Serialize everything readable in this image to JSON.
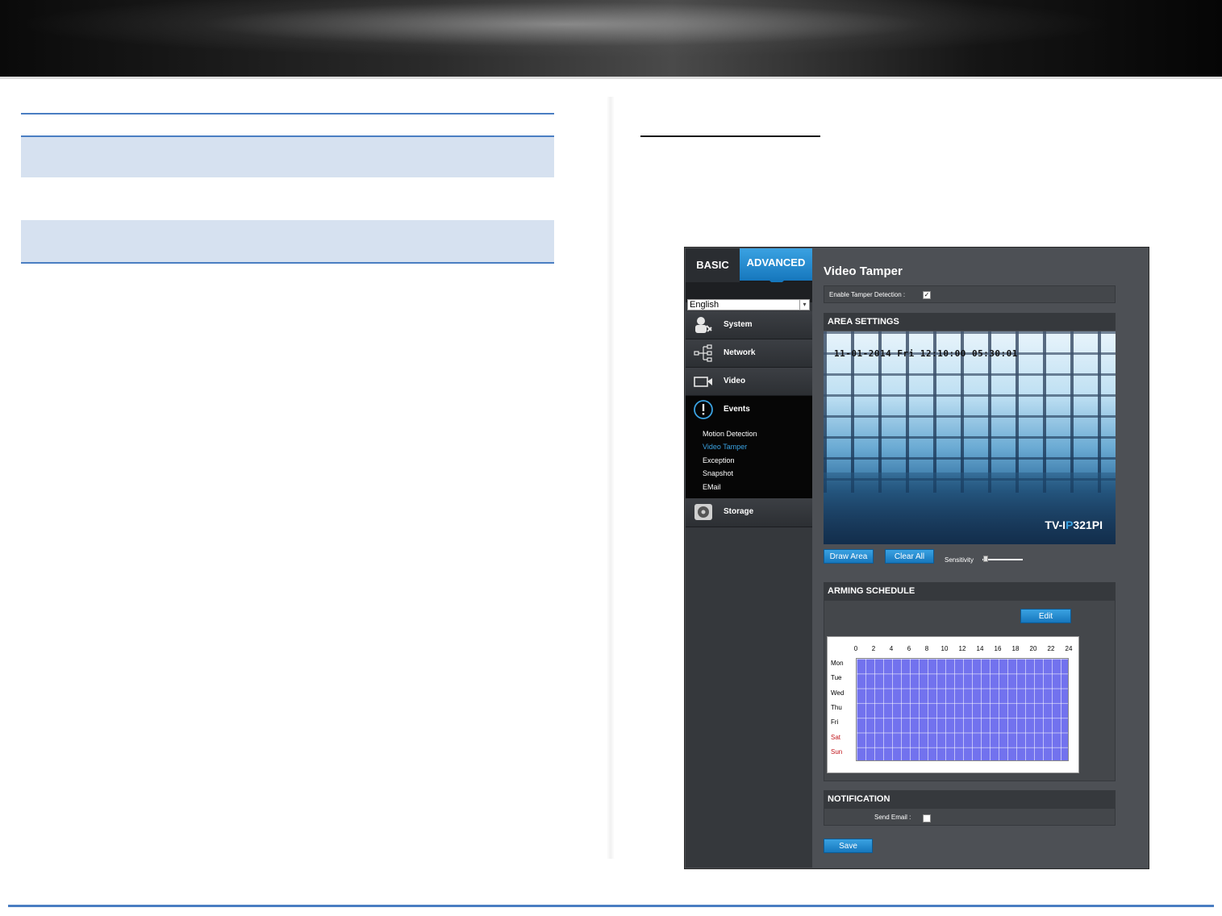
{
  "app": {
    "tabs": {
      "basic": "BASIC",
      "advanced": "ADVANCED"
    },
    "language": "English",
    "menu": [
      {
        "label": "System",
        "icon": "system-admin-icon"
      },
      {
        "label": "Network",
        "icon": "network-icon"
      },
      {
        "label": "Video",
        "icon": "video-camera-icon"
      },
      {
        "label": "Events",
        "icon": "alert-icon"
      },
      {
        "label": "Storage",
        "icon": "disk-icon"
      }
    ],
    "events_submenu": [
      "Motion Detection",
      "Video Tamper",
      "Exception",
      "Snapshot",
      "EMail"
    ],
    "active_submenu": "Video Tamper",
    "page_title": "Video Tamper",
    "enable_label": "Enable Tamper Detection :",
    "enable_checked": true,
    "area_settings": {
      "title": "AREA SETTINGS",
      "timestamp": "11-01-2014 Fri 12:10:00 05:30:01",
      "watermark_pre": "TV-I",
      "watermark_p": "P",
      "watermark_post": "321PI",
      "draw_area": "Draw Area",
      "clear_all": "Clear All",
      "sensitivity_label": "Sensitivity",
      "sensitivity_value": 0.05
    },
    "arming_schedule": {
      "title": "ARMING SCHEDULE",
      "edit": "Edit",
      "hours": [
        "0",
        "2",
        "4",
        "6",
        "8",
        "10",
        "12",
        "14",
        "16",
        "18",
        "20",
        "22",
        "24"
      ],
      "days": [
        "Mon",
        "Tue",
        "Wed",
        "Thu",
        "Fri",
        "Sat",
        "Sun"
      ]
    },
    "notification": {
      "title": "NOTIFICATION",
      "send_email_label": "Send Email :",
      "send_email_checked": false
    },
    "save": "Save"
  },
  "colors": {
    "accent_blue": "#3aa2e2",
    "doc_line_blue": "#4a7ec2",
    "doc_band": "#d6e1f0",
    "schedule_fill": "#7272ee",
    "weekend_red": "#c0141a"
  }
}
